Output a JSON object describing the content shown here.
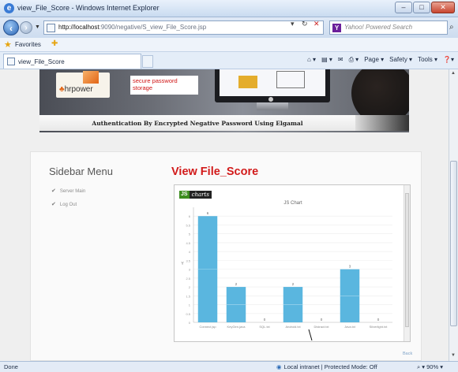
{
  "window": {
    "title": "view_File_Score - Windows Internet Explorer",
    "min": "–",
    "max": "□",
    "close": "✕"
  },
  "addressbar": {
    "url_host": "http://localhost",
    "url_rest": ":9090/negative/S_view_File_Score.jsp",
    "refresh": "↻",
    "stop": "✕",
    "search_placeholder": "Yahoo! Powered Search",
    "search_logo": "Y"
  },
  "favorites": {
    "label": "Favorites"
  },
  "tab": {
    "label": "view_File_Score"
  },
  "commandbar": {
    "page": "Page",
    "safety": "Safety",
    "tools": "Tools"
  },
  "banner": {
    "logo_text": "hrpower",
    "password_text": "secure password storage",
    "tagline": "Authentication By Encrypted Negative Password Using Elgamal"
  },
  "sidebar": {
    "title": "Sidebar Menu",
    "items": [
      {
        "label": "Server Main"
      },
      {
        "label": "Log Out"
      }
    ]
  },
  "main": {
    "heading": "View File_Score",
    "footer_link": "Back"
  },
  "jscharts_badge": {
    "js": "JS",
    "charts": "charts"
  },
  "chart_data": {
    "type": "bar",
    "title": "JS Chart",
    "ylabel": "Y",
    "xlabel": "",
    "categories": [
      "Connect.jsp",
      "KeyGen.java",
      "SQL.txt",
      "Android.txt",
      "Distract.txt",
      "Java.txt",
      "Silverlight.txt"
    ],
    "values": [
      6,
      2,
      0,
      2,
      0,
      3,
      0
    ],
    "yticks": [
      "0",
      "0.5",
      "1",
      "1.5",
      "2",
      "2.5",
      "3",
      "3.5",
      "4",
      "4.5",
      "5",
      "5.5",
      "6"
    ],
    "ylim": [
      0,
      6.5
    ],
    "grid": true,
    "bar_color": "#5ab6df"
  },
  "statusbar": {
    "left": "Done",
    "zone": "Local intranet | Protected Mode: Off",
    "zoom": "90%"
  }
}
